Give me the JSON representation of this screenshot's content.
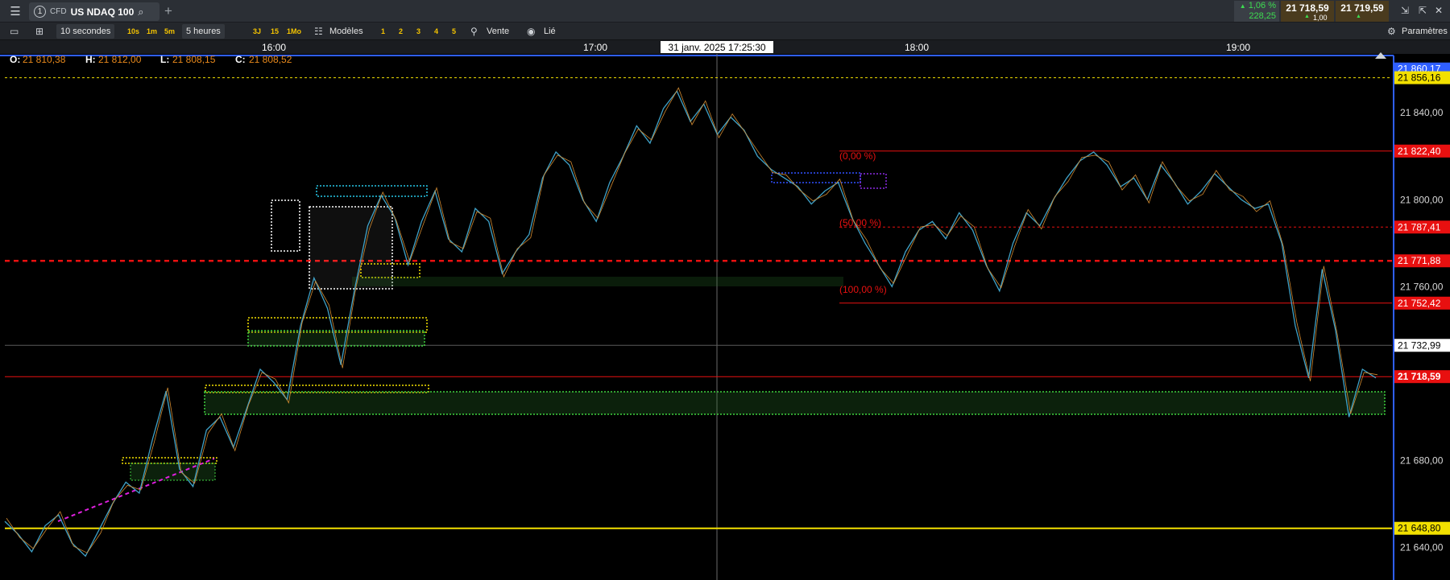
{
  "topbar": {
    "menu_icon": "hamburger-icon",
    "tab_number": "1",
    "tab_tag": "CFD",
    "tab_title": "US NDAQ 100",
    "add_tab": "+",
    "change_pct": "1,06 %",
    "change_abs": "228,25",
    "bid": "21 718,59",
    "ask": "21 719,59",
    "spread": "1,00",
    "win_controls": [
      "⇲",
      "⇱",
      "✕"
    ]
  },
  "toolbar": {
    "interval": "10 secondes",
    "quick_intervals": [
      "10s",
      "1m",
      "5m"
    ],
    "range": "5 heures",
    "range_buttons": [
      "3J",
      "15",
      "1Mo"
    ],
    "models": "Modèles",
    "model_slots": [
      "1",
      "2",
      "3",
      "4",
      "5"
    ],
    "sell": "Vente",
    "linked": "Lié",
    "settings": "Paramètres"
  },
  "chart_data": {
    "type": "line",
    "instrument": "US NDAQ 100",
    "time_ticks": [
      "16:00",
      "17:00",
      "18:00",
      "19:00"
    ],
    "crosshair_time": "31 janv. 2025 17:25:30",
    "ohlc": {
      "O_label": "O:",
      "O": "21 810,38",
      "H_label": "H:",
      "H": "21 812,00",
      "L_label": "L:",
      "L": "21 808,15",
      "C_label": "C:",
      "C": "21 808,52"
    },
    "y_ticks": [
      "21 840,00",
      "21 800,00",
      "21 760,00",
      "21 680,00",
      "21 640,00"
    ],
    "ylim": [
      21625,
      21866
    ],
    "price_levels": [
      {
        "value": 21860.17,
        "label": "21 860,17",
        "color": "#2f5fff"
      },
      {
        "value": 21856.16,
        "label": "21 856,16",
        "color": "#f2e000"
      },
      {
        "value": 21822.4,
        "label": "21 822,40",
        "color": "#e81010"
      },
      {
        "value": 21787.41,
        "label": "21 787,41",
        "color": "#e81010"
      },
      {
        "value": 21771.88,
        "label": "21 771,88",
        "color": "#e81010"
      },
      {
        "value": 21752.42,
        "label": "21 752,42",
        "color": "#e81010"
      },
      {
        "value": 21732.99,
        "label": "21 732,99",
        "color": "#ffffff"
      },
      {
        "value": 21718.59,
        "label": "21 718,59",
        "color": "#e81010"
      },
      {
        "value": 21648.8,
        "label": "21 648,80",
        "color": "#f2e000"
      }
    ],
    "fib_labels": [
      "(0,00 %)",
      "(50,00 %)",
      "(100,00 %)"
    ],
    "price_series": [
      21652,
      21646,
      21638,
      21650,
      21655,
      21642,
      21636,
      21648,
      21660,
      21670,
      21665,
      21690,
      21712,
      21676,
      21668,
      21694,
      21700,
      21686,
      21704,
      21722,
      21716,
      21708,
      21742,
      21764,
      21750,
      21724,
      21758,
      21788,
      21802,
      21792,
      21770,
      21790,
      21804,
      21782,
      21776,
      21796,
      21790,
      21766,
      21776,
      21784,
      21810,
      21822,
      21816,
      21800,
      21790,
      21808,
      21820,
      21834,
      21826,
      21842,
      21850,
      21836,
      21844,
      21830,
      21838,
      21832,
      21820,
      21814,
      21810,
      21806,
      21798,
      21804,
      21808,
      21792,
      21780,
      21770,
      21760,
      21776,
      21786,
      21790,
      21782,
      21794,
      21786,
      21770,
      21758,
      21780,
      21794,
      21788,
      21800,
      21810,
      21818,
      21822,
      21816,
      21806,
      21810,
      21800,
      21816,
      21808,
      21798,
      21804,
      21812,
      21806,
      21800,
      21796,
      21798,
      21780,
      21742,
      21718,
      21768,
      21740,
      21700,
      21722,
      21718
    ]
  }
}
